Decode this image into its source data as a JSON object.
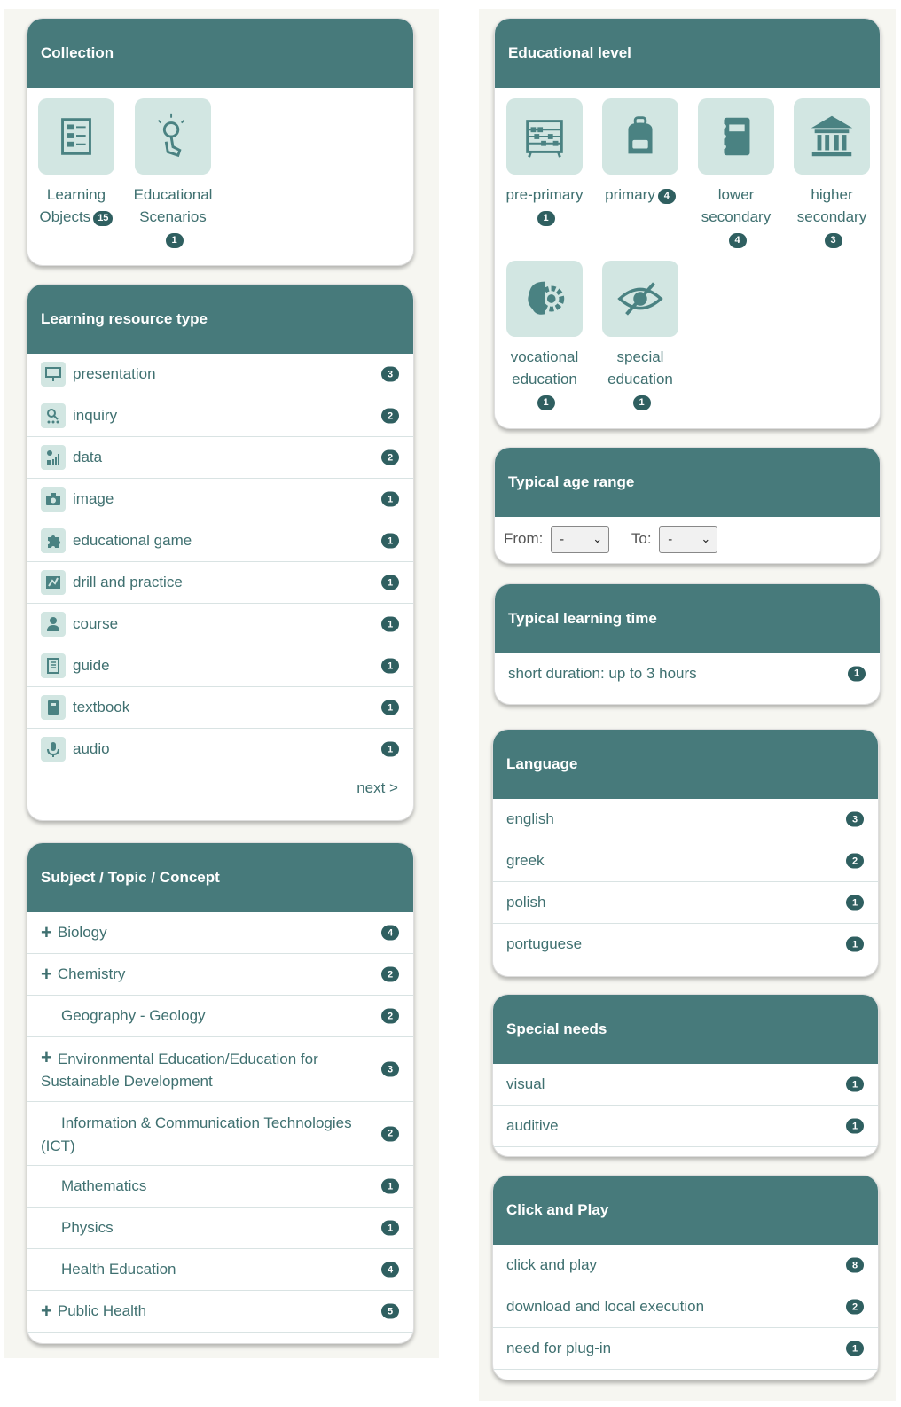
{
  "collection": {
    "title": "Collection",
    "items": [
      {
        "label1": "Learning",
        "label2": "Objects",
        "count": "15"
      },
      {
        "label1": "Educational",
        "label2": "Scenarios",
        "count": "1"
      }
    ]
  },
  "resource_type": {
    "title": "Learning resource type",
    "items": [
      {
        "label": "presentation",
        "count": "3",
        "icon": "presentation-icon"
      },
      {
        "label": "inquiry",
        "count": "2",
        "icon": "inquiry-icon"
      },
      {
        "label": "data",
        "count": "2",
        "icon": "data-icon"
      },
      {
        "label": "image",
        "count": "1",
        "icon": "camera-icon"
      },
      {
        "label": "educational game",
        "count": "1",
        "icon": "puzzle-icon"
      },
      {
        "label": "drill and practice",
        "count": "1",
        "icon": "drill-icon"
      },
      {
        "label": "course",
        "count": "1",
        "icon": "teacher-icon"
      },
      {
        "label": "guide",
        "count": "1",
        "icon": "guide-book-icon"
      },
      {
        "label": "textbook",
        "count": "1",
        "icon": "textbook-icon"
      },
      {
        "label": "audio",
        "count": "1",
        "icon": "microphone-icon"
      }
    ],
    "next_label": "next >"
  },
  "subject": {
    "title": "Subject / Topic / Concept",
    "items": [
      {
        "label": "Biology",
        "count": "4",
        "expandable": true
      },
      {
        "label": "Chemistry",
        "count": "2",
        "expandable": true
      },
      {
        "label": "Geography - Geology",
        "count": "2",
        "expandable": false
      },
      {
        "label1": "Environmental Education/Education for",
        "label2": "Sustainable Development",
        "count": "3",
        "expandable": true
      },
      {
        "label1": "Information & Communication Technologies",
        "label2": "(ICT)",
        "count": "2",
        "expandable": false
      },
      {
        "label": "Mathematics",
        "count": "1",
        "expandable": false
      },
      {
        "label": "Physics",
        "count": "1",
        "expandable": false
      },
      {
        "label": "Health Education",
        "count": "4",
        "expandable": false
      },
      {
        "label": "Public Health",
        "count": "5",
        "expandable": true
      }
    ]
  },
  "edu_level": {
    "title": "Educational level",
    "items": [
      {
        "label1": "pre-primary",
        "label2": "",
        "count": "1",
        "icon": "abacus-icon"
      },
      {
        "label1": "primary",
        "label2": "",
        "count": "4",
        "icon": "backpack-icon"
      },
      {
        "label1": "lower",
        "label2": "secondary",
        "count": "4",
        "icon": "notebook-icon"
      },
      {
        "label1": "higher",
        "label2": "secondary",
        "count": "3",
        "icon": "building-icon"
      },
      {
        "label1": "vocational",
        "label2": "education",
        "count": "1",
        "icon": "brain-gear-icon"
      },
      {
        "label1": "special",
        "label2": "education",
        "count": "1",
        "icon": "eye-slash-icon"
      }
    ]
  },
  "age_range": {
    "title": "Typical age range",
    "from_label": "From:",
    "from_value": "-",
    "to_label": "To:",
    "to_value": "-"
  },
  "learning_time": {
    "title": "Typical learning time",
    "items": [
      {
        "label": "short duration: up to 3 hours",
        "count": "1"
      }
    ]
  },
  "language": {
    "title": "Language",
    "items": [
      {
        "label": "english",
        "count": "3"
      },
      {
        "label": "greek",
        "count": "2"
      },
      {
        "label": "polish",
        "count": "1"
      },
      {
        "label": "portuguese",
        "count": "1"
      }
    ]
  },
  "special_needs": {
    "title": "Special needs",
    "items": [
      {
        "label": "visual",
        "count": "1"
      },
      {
        "label": "auditive",
        "count": "1"
      }
    ]
  },
  "click_play": {
    "title": "Click and Play",
    "items": [
      {
        "label": "click and play",
        "count": "8"
      },
      {
        "label": "download and local execution",
        "count": "2"
      },
      {
        "label": "need for plug-in",
        "count": "1"
      }
    ]
  }
}
